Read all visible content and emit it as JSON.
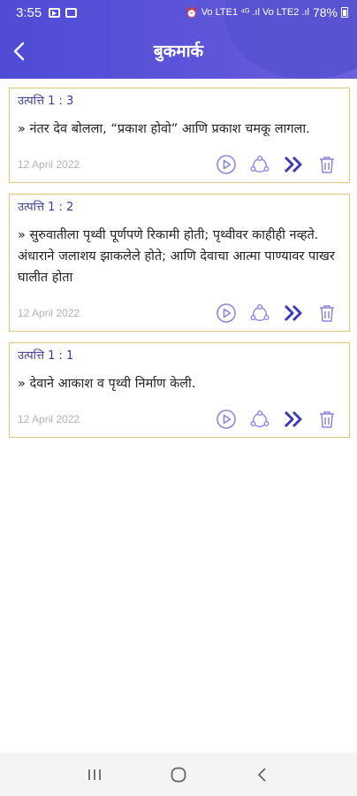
{
  "status_bar": {
    "time": "3:55",
    "signal_text": "Vo LTE1 ⁴ᴳ .ıl Vo LTE2 .ıl",
    "battery": "78%"
  },
  "header": {
    "title": "बुकमार्क"
  },
  "bookmarks": [
    {
      "reference": "उत्पत्ति 1 : 3",
      "text": "» नंतर देव बोलला, “प्रकाश होवो” आणि प्रकाश चमकू लागला.",
      "date": "12 April 2022"
    },
    {
      "reference": "उत्पत्ति 1 : 2",
      "text": "» सुरुवातीला पृथ्वी पूर्णपणे रिकामी होती; पृथ्वीवर काहीही नव्हते. अंधाराने जलाशय झाकलेले होते; आणि देवाचा आत्मा पाण्यावर पाखर घालीत होता",
      "date": "12 April 2022"
    },
    {
      "reference": "उत्पत्ति 1 : 1",
      "text": "» देवाने आकाश व पृथ्वी निर्माण केली.",
      "date": "12 April 2022"
    }
  ],
  "colors": {
    "primary": "#4f4bd6",
    "card_border": "#e2c97a",
    "icon_light": "#8a86e0",
    "icon_dark": "#3d3ab8"
  }
}
